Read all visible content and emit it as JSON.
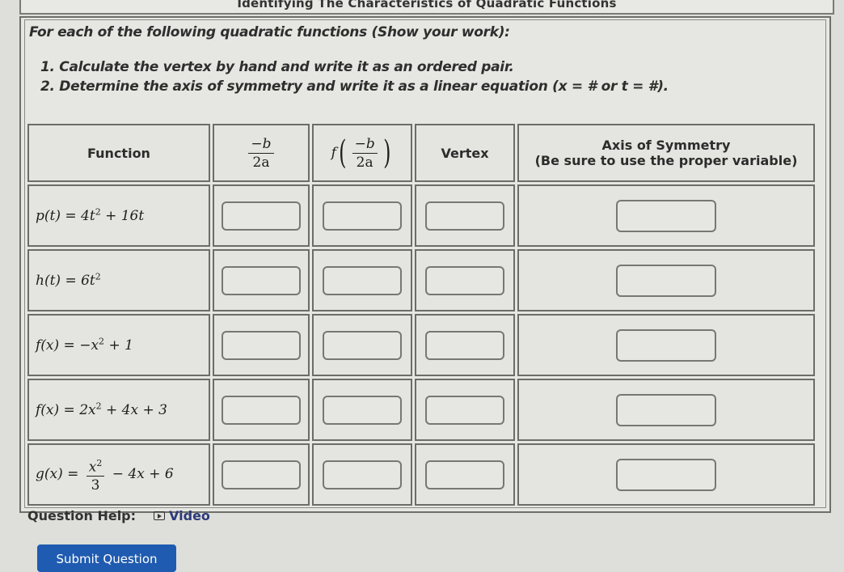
{
  "page_title": "Identifying The Characteristics of Quadratic Functions",
  "instructions": {
    "intro": "For each of the following quadratic functions (Show your work):",
    "steps": [
      "1. Calculate the vertex by hand and write it as an ordered pair.",
      "2. Determine the axis of symmetry and write it as a linear equation (x = # or t = #)."
    ]
  },
  "table": {
    "headers": {
      "function": "Function",
      "neg_b_over_2a": {
        "numerator": "−b",
        "denominator": "2a"
      },
      "f_of_neg_b_over_2a": {
        "fn": "f",
        "numerator": "−b",
        "denominator": "2a"
      },
      "vertex": "Vertex",
      "axis_line1": "Axis of Symmetry",
      "axis_line2": "(Be sure to use the proper variable)"
    },
    "rows": [
      {
        "lhs": "p(t) = ",
        "parts": [
          "4t",
          "2",
          " + 16t"
        ],
        "plain": "p(t) = 4t^2 + 16t",
        "answers": {
          "neg_b_over_2a": "",
          "f_value": "",
          "vertex": "",
          "axis": ""
        }
      },
      {
        "lhs": "h(t) = ",
        "parts": [
          "6t",
          "2",
          ""
        ],
        "plain": "h(t) = 6t^2",
        "answers": {
          "neg_b_over_2a": "",
          "f_value": "",
          "vertex": "",
          "axis": ""
        }
      },
      {
        "lhs": "f(x) = ",
        "parts": [
          "−x",
          "2",
          " + 1"
        ],
        "plain": "f(x) = -x^2 + 1",
        "answers": {
          "neg_b_over_2a": "",
          "f_value": "",
          "vertex": "",
          "axis": ""
        }
      },
      {
        "lhs": "f(x) = ",
        "parts": [
          "2x",
          "2",
          " + 4x + 3"
        ],
        "plain": "f(x) = 2x^2 + 4x + 3",
        "answers": {
          "neg_b_over_2a": "",
          "f_value": "",
          "vertex": "",
          "axis": ""
        }
      },
      {
        "lhs": "g(x) = ",
        "frac_num_base": "x",
        "frac_num_exp": "2",
        "frac_den": "3",
        "rest": " − 4x + 6",
        "plain": "g(x) = x^2/3 - 4x + 6",
        "answers": {
          "neg_b_over_2a": "",
          "f_value": "",
          "vertex": "",
          "axis": ""
        }
      }
    ]
  },
  "help": {
    "label": "Question Help:",
    "video_icon": "play-video-icon",
    "video_label": "Video"
  },
  "submit": {
    "label": "Submit Question"
  },
  "colors": {
    "background": "#dedfda",
    "border": "#6c6c6a",
    "link": "#2d3a7a",
    "submit_button": "#1f5bb0"
  }
}
